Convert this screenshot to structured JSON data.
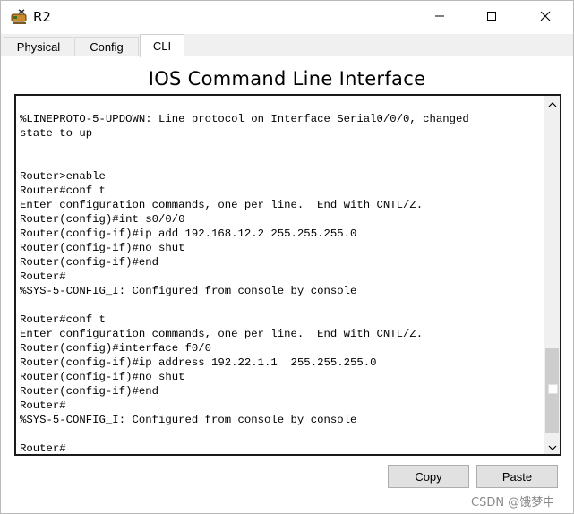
{
  "window": {
    "title": "R2",
    "icon": "router-device-icon"
  },
  "tabs": [
    {
      "label": "Physical",
      "active": false
    },
    {
      "label": "Config",
      "active": false
    },
    {
      "label": "CLI",
      "active": true
    }
  ],
  "cli": {
    "heading": "IOS Command Line Interface",
    "lines": [
      "%LINEPROTO-5-UPDOWN: Line protocol on Interface Serial0/0/0, changed",
      "state to up",
      "",
      "",
      "Router>enable",
      "Router#conf t",
      "Enter configuration commands, one per line.  End with CNTL/Z.",
      "Router(config)#int s0/0/0",
      "Router(config-if)#ip add 192.168.12.2 255.255.255.0",
      "Router(config-if)#no shut",
      "Router(config-if)#end",
      "Router#",
      "%SYS-5-CONFIG_I: Configured from console by console",
      "",
      "Router#conf t",
      "Enter configuration commands, one per line.  End with CNTL/Z.",
      "Router(config)#interface f0/0",
      "Router(config-if)#ip address 192.22.1.1  255.255.255.0",
      "Router(config-if)#no shut",
      "Router(config-if)#end",
      "Router#",
      "%SYS-5-CONFIG_I: Configured from console by console",
      "",
      "Router#"
    ]
  },
  "buttons": {
    "copy": "Copy",
    "paste": "Paste"
  },
  "watermark": "CSDN @饿梦中"
}
